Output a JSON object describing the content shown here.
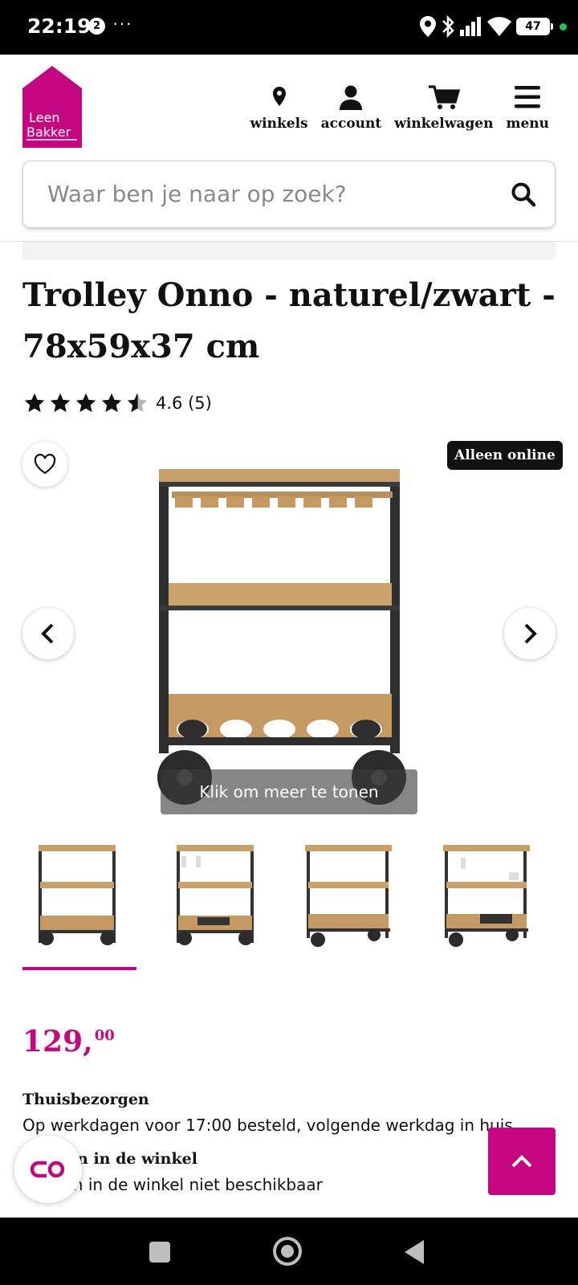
{
  "status_bar": {
    "time": "22:19",
    "badge": "2",
    "dots": "···",
    "battery": "47"
  },
  "header": {
    "logo_line1": "Leen",
    "logo_line2": "Bakker",
    "nav": [
      {
        "label": "winkels",
        "icon": "location-pin-icon"
      },
      {
        "label": "account",
        "icon": "person-icon"
      },
      {
        "label": "winkelwagen",
        "icon": "cart-icon"
      },
      {
        "label": "menu",
        "icon": "hamburger-icon"
      }
    ]
  },
  "search": {
    "placeholder": "Waar ben je naar op zoek?"
  },
  "product": {
    "title": "Trolley Onno - naturel/zwart - 78x59x37 cm",
    "rating_value": 4.6,
    "rating_text": "4.6 (5)",
    "stars_total": 5,
    "badge": "Alleen online",
    "overlay_text": "Klik om meer te tonen",
    "thumbnail_count": 4,
    "selected_thumbnail": 1
  },
  "price": {
    "whole": "129,",
    "cents": "00"
  },
  "delivery": {
    "home_title": "Thuisbezorgen",
    "home_text": "Op werkdagen voor 17:00 besteld, volgende werkdag in huis",
    "store_title": "Afhalen in de winkel",
    "store_text": "Afhalen in de winkel niet beschikbaar"
  },
  "colors": {
    "brand": "#c4077f",
    "text": "#111111"
  }
}
